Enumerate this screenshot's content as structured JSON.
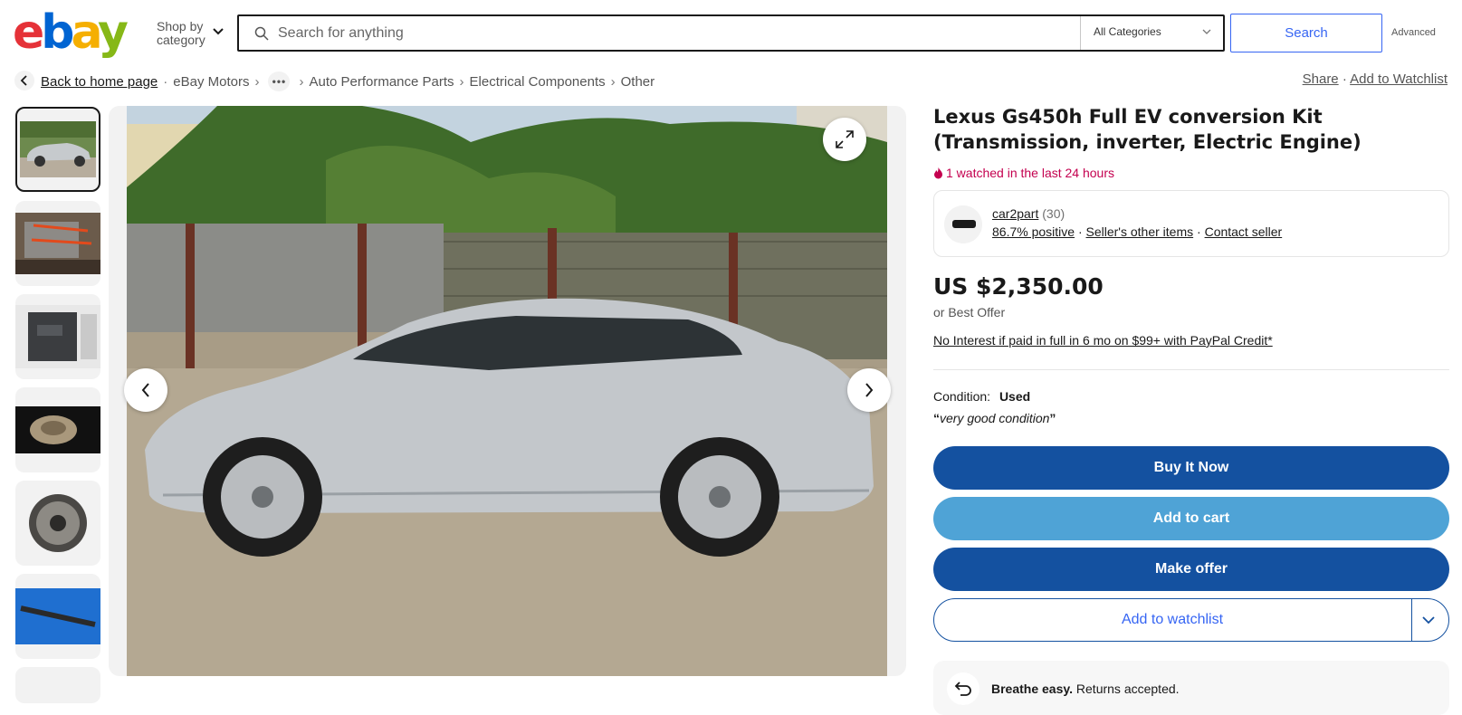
{
  "header": {
    "logo_letters": [
      "e",
      "b",
      "a",
      "y"
    ],
    "shop_by_line1": "Shop by",
    "shop_by_line2": "category",
    "search_placeholder": "Search for anything",
    "category_select": "All Categories",
    "search_button": "Search",
    "advanced_link": "Advanced"
  },
  "breadcrumb": {
    "back": "Back to home page",
    "items": [
      "eBay Motors",
      "Auto Performance Parts",
      "Electrical Components",
      "Other"
    ],
    "dots": "•••"
  },
  "page_actions": {
    "share": "Share",
    "separator": "·",
    "watchlist": "Add to Watchlist"
  },
  "gallery": {
    "thumbnails": [
      "car-side-photo",
      "engine-bay-photo",
      "inverter-box-photo",
      "motor-photo",
      "clutch-disc-photo",
      "driveshaft-photo",
      "more-photo"
    ],
    "selected_index": 0
  },
  "listing": {
    "title": "Lexus Gs450h Full EV conversion Kit (Transmission, inverter, Electric Engine)",
    "watched": "1 watched in the last 24 hours",
    "seller": {
      "name": "car2part",
      "feedback_count": "(30)",
      "positive": "86.7% positive",
      "other_items": "Seller's other items",
      "contact": "Contact seller",
      "dot": "·"
    },
    "price": "US $2,350.00",
    "best_offer": "or Best Offer",
    "paypal": "No Interest if paid in full in 6 mo on $99+ with PayPal Credit*",
    "condition_label": "Condition:",
    "condition_value": "Used",
    "condition_note_open": "“",
    "condition_note": "very good condition",
    "condition_note_close": "”",
    "buttons": {
      "buy_now": "Buy It Now",
      "add_to_cart": "Add to cart",
      "make_offer": "Make offer",
      "add_to_watchlist": "Add to watchlist"
    },
    "returns": {
      "bold": "Breathe easy.",
      "text": "Returns accepted."
    }
  },
  "colors": {
    "primary": "#1451a0",
    "secondary": "#4fa3d6",
    "link": "#3665f3",
    "urgency": "#c4004f"
  }
}
